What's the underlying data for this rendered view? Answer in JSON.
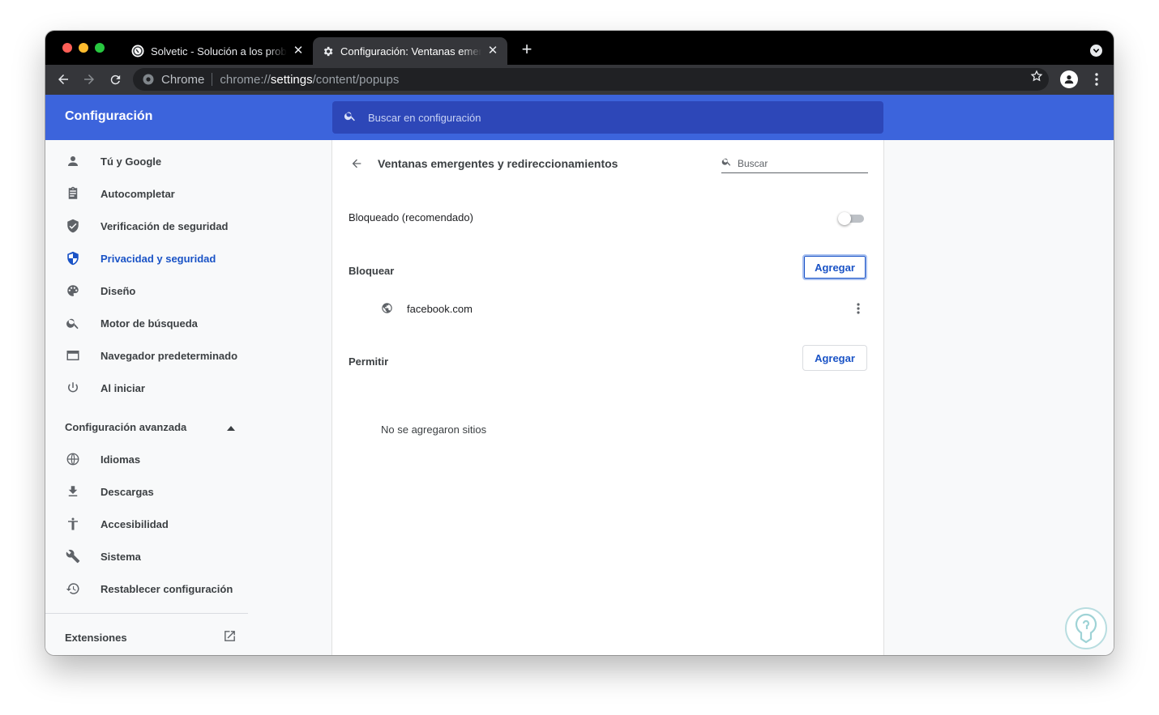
{
  "tabs": [
    {
      "title": "Solvetic - Solución a los problemas"
    },
    {
      "title": "Configuración: Ventanas emergentes"
    }
  ],
  "toolbar": {
    "omnibox_chip": "Chrome",
    "url_prefix": "chrome://",
    "url_host": "settings",
    "url_path": "/content/popups"
  },
  "header": {
    "title": "Configuración",
    "search_placeholder": "Buscar en configuración"
  },
  "sidebar": {
    "items": [
      {
        "label": "Tú y Google",
        "icon": "person-icon"
      },
      {
        "label": "Autocompletar",
        "icon": "clipboard-icon"
      },
      {
        "label": "Verificación de seguridad",
        "icon": "shield-check-icon"
      },
      {
        "label": "Privacidad y seguridad",
        "icon": "privacy-shield-icon",
        "selected": true
      },
      {
        "label": "Diseño",
        "icon": "palette-icon"
      },
      {
        "label": "Motor de búsqueda",
        "icon": "search-icon"
      },
      {
        "label": "Navegador predeterminado",
        "icon": "browser-window-icon"
      },
      {
        "label": "Al iniciar",
        "icon": "power-icon"
      }
    ],
    "advanced_label": "Configuración avanzada",
    "advanced_items": [
      {
        "label": "Idiomas",
        "icon": "globe-icon"
      },
      {
        "label": "Descargas",
        "icon": "download-icon"
      },
      {
        "label": "Accesibilidad",
        "icon": "accessibility-icon"
      },
      {
        "label": "Sistema",
        "icon": "wrench-icon"
      },
      {
        "label": "Restablecer configuración",
        "icon": "history-icon"
      }
    ],
    "extensions_label": "Extensiones"
  },
  "main": {
    "title": "Ventanas emergentes y redireccionamientos",
    "search_placeholder": "Buscar",
    "blocked_label": "Bloqueado (recomendado)",
    "blocked_toggle_on": false,
    "block_section": {
      "label": "Bloquear",
      "add_label": "Agregar",
      "sites": [
        "facebook.com"
      ]
    },
    "allow_section": {
      "label": "Permitir",
      "add_label": "Agregar",
      "empty_text": "No se agregaron sitios"
    }
  },
  "colors": {
    "accent": "#3c64dc",
    "search_bg": "#2d47b8",
    "link_blue": "#1a53c6"
  }
}
